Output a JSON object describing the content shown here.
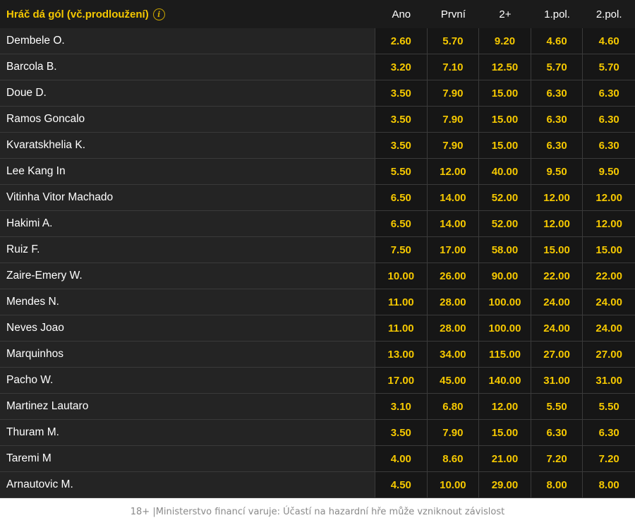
{
  "market": {
    "title": "Hráč dá gól (vč.prodloužení)",
    "info_icon": "info-icon",
    "columns": [
      "Ano",
      "První",
      "2+",
      "1.pol.",
      "2.pol."
    ]
  },
  "players": [
    {
      "name": "Dembele O.",
      "odds": [
        "2.60",
        "5.70",
        "9.20",
        "4.60",
        "4.60"
      ]
    },
    {
      "name": "Barcola B.",
      "odds": [
        "3.20",
        "7.10",
        "12.50",
        "5.70",
        "5.70"
      ]
    },
    {
      "name": "Doue D.",
      "odds": [
        "3.50",
        "7.90",
        "15.00",
        "6.30",
        "6.30"
      ]
    },
    {
      "name": "Ramos Goncalo",
      "odds": [
        "3.50",
        "7.90",
        "15.00",
        "6.30",
        "6.30"
      ]
    },
    {
      "name": "Kvaratskhelia K.",
      "odds": [
        "3.50",
        "7.90",
        "15.00",
        "6.30",
        "6.30"
      ]
    },
    {
      "name": "Lee Kang In",
      "odds": [
        "5.50",
        "12.00",
        "40.00",
        "9.50",
        "9.50"
      ]
    },
    {
      "name": "Vitinha Vitor Machado",
      "odds": [
        "6.50",
        "14.00",
        "52.00",
        "12.00",
        "12.00"
      ]
    },
    {
      "name": "Hakimi A.",
      "odds": [
        "6.50",
        "14.00",
        "52.00",
        "12.00",
        "12.00"
      ]
    },
    {
      "name": "Ruiz F.",
      "odds": [
        "7.50",
        "17.00",
        "58.00",
        "15.00",
        "15.00"
      ]
    },
    {
      "name": "Zaire-Emery W.",
      "odds": [
        "10.00",
        "26.00",
        "90.00",
        "22.00",
        "22.00"
      ]
    },
    {
      "name": "Mendes N.",
      "odds": [
        "11.00",
        "28.00",
        "100.00",
        "24.00",
        "24.00"
      ]
    },
    {
      "name": "Neves Joao",
      "odds": [
        "11.00",
        "28.00",
        "100.00",
        "24.00",
        "24.00"
      ]
    },
    {
      "name": "Marquinhos",
      "odds": [
        "13.00",
        "34.00",
        "115.00",
        "27.00",
        "27.00"
      ]
    },
    {
      "name": "Pacho W.",
      "odds": [
        "17.00",
        "45.00",
        "140.00",
        "31.00",
        "31.00"
      ]
    },
    {
      "name": "Martinez Lautaro",
      "odds": [
        "3.10",
        "6.80",
        "12.00",
        "5.50",
        "5.50"
      ]
    },
    {
      "name": "Thuram M.",
      "odds": [
        "3.50",
        "7.90",
        "15.00",
        "6.30",
        "6.30"
      ]
    },
    {
      "name": "Taremi M",
      "odds": [
        "4.00",
        "8.60",
        "21.00",
        "7.20",
        "7.20"
      ]
    },
    {
      "name": "Arnautovic M.",
      "odds": [
        "4.50",
        "10.00",
        "29.00",
        "8.00",
        "8.00"
      ]
    }
  ],
  "footer": {
    "disclaimer": "18+ |Ministerstvo financí varuje: Účastí na hazardní hře může vzniknout závislost"
  },
  "colors": {
    "accent": "#f5c800",
    "row_bg": "#242424",
    "odds_bg": "#161616",
    "header_bg": "#1b1b1b"
  }
}
